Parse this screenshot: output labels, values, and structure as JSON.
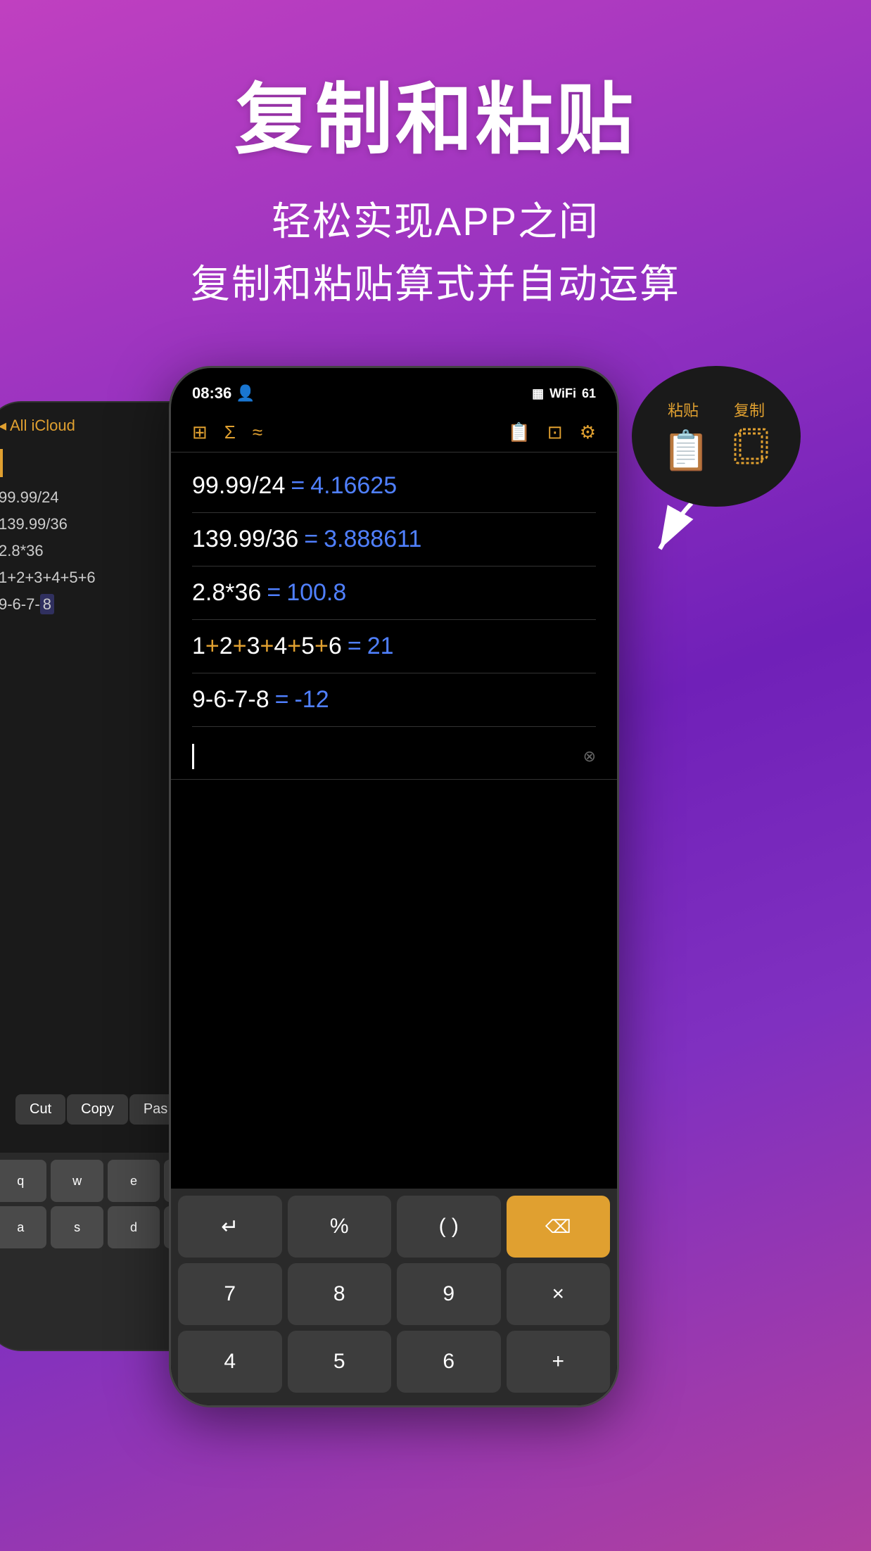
{
  "header": {
    "main_title": "复制和粘贴",
    "subtitle_line1": "轻松实现APP之间",
    "subtitle_line2": "复制和粘贴算式并自动运算"
  },
  "bubble": {
    "paste_label": "粘贴",
    "copy_label": "复制"
  },
  "bg_phone": {
    "nav_back": "< All iCloud",
    "calc_items": [
      "99.99/24",
      "139.99/36",
      "2.8*36",
      "1+2+3+4+5+6",
      "9-6-7-8"
    ],
    "context_menu": {
      "cut": "Cut",
      "copy": "Copy",
      "paste": "Pas..."
    }
  },
  "main_phone": {
    "status": {
      "time": "08:36",
      "battery": "61"
    },
    "calc_rows": [
      {
        "expr": "99.99/24",
        "equals": "=",
        "result": "4.16625"
      },
      {
        "expr": "139.99/36",
        "equals": "=",
        "result": "3.888611"
      },
      {
        "expr": "2.8*36",
        "equals": "=",
        "result": "100.8"
      },
      {
        "expr_colored": "1+2+3+4+5+6",
        "equals": "=",
        "result": "21"
      },
      {
        "expr": "9-6-7-8",
        "equals": "=",
        "result": "-12"
      }
    ],
    "keyboard": {
      "row1": [
        {
          "label": "↵"
        },
        {
          "label": "%"
        },
        {
          "label": "( )"
        },
        {
          "label": "⌫",
          "type": "orange"
        }
      ],
      "row2": [
        {
          "label": "7"
        },
        {
          "label": "8"
        },
        {
          "label": "9"
        },
        {
          "label": "×"
        }
      ],
      "row3": [
        {
          "label": "4"
        },
        {
          "label": "5"
        },
        {
          "label": "6"
        },
        {
          "label": "+"
        }
      ]
    }
  }
}
